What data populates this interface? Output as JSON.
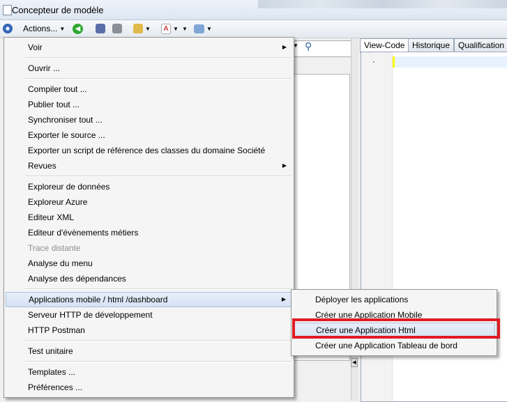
{
  "window": {
    "title": "Concepteur de modèle"
  },
  "toolbar": {
    "actions_label": "Actions..."
  },
  "tabs": [
    {
      "label": "View-Code",
      "active": true
    },
    {
      "label": "Historique",
      "active": false
    },
    {
      "label": "Qualification",
      "active": false
    }
  ],
  "menu": {
    "items": [
      {
        "label": "Voir",
        "submenu": true
      },
      {
        "label": "Ouvrir ..."
      },
      {
        "label": "Compiler tout ..."
      },
      {
        "label": "Publier tout ..."
      },
      {
        "label": "Synchroniser tout ..."
      },
      {
        "label": "Exporter le source ..."
      },
      {
        "label": "Exporter un script de référence des classes du domaine Société"
      },
      {
        "label": "Revues",
        "submenu": true
      },
      {
        "label": "Exploreur de données"
      },
      {
        "label": "Exploreur Azure"
      },
      {
        "label": "Editeur XML"
      },
      {
        "label": "Editeur d'évènements métiers"
      },
      {
        "label": "Trace distante",
        "disabled": true
      },
      {
        "label": "Analyse du menu"
      },
      {
        "label": "Analyse des dépendances"
      },
      {
        "label": "Applications mobile / html /dashboard",
        "submenu": true,
        "highlighted": true
      },
      {
        "label": "Serveur HTTP de développement"
      },
      {
        "label": "HTTP Postman"
      },
      {
        "label": "Test unitaire"
      },
      {
        "label": "Templates ..."
      },
      {
        "label": "Préférences ..."
      }
    ]
  },
  "submenu": {
    "items": [
      {
        "label": "Déployer les applications"
      },
      {
        "label": "Créer une Application Mobile"
      },
      {
        "label": "Créer une Application Html",
        "highlighted": true
      },
      {
        "label": "Créer une Application Tableau de bord"
      }
    ]
  },
  "colors": {
    "highlight_box": "#e01b24",
    "menu_highlight": "#d6e2f5"
  }
}
